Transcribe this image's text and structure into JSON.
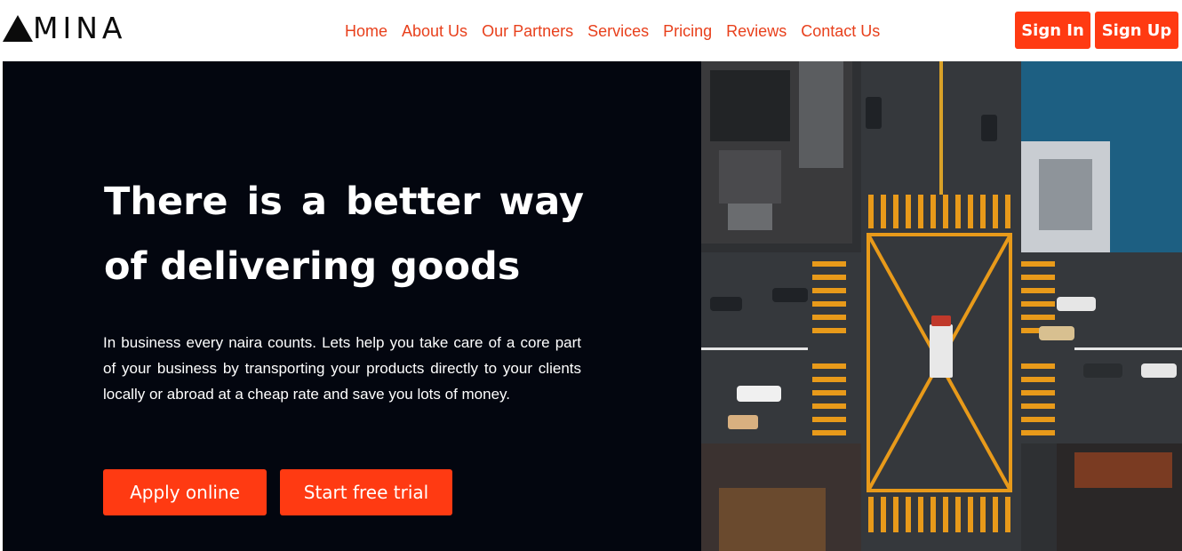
{
  "brand": {
    "logo_text": "MINA",
    "logo_icon": "triangle-a-icon"
  },
  "nav": {
    "items": [
      {
        "label": "Home"
      },
      {
        "label": "About Us"
      },
      {
        "label": "Our Partners"
      },
      {
        "label": "Services"
      },
      {
        "label": "Pricing"
      },
      {
        "label": "Reviews"
      },
      {
        "label": "Contact Us"
      }
    ]
  },
  "auth": {
    "sign_in": "Sign In",
    "sign_up": "Sign Up"
  },
  "hero": {
    "title": "There is a better way of delivering goods",
    "description": "In business every naira counts. Lets help you take care of a core part of your business by transporting your products directly to your clients locally or abroad at a cheap rate and save you lots of money.",
    "apply_label": "Apply online",
    "trial_label": "Start free trial"
  },
  "colors": {
    "accent": "#ff3a12",
    "nav_link": "#e8401c",
    "hero_bg": "#03060f",
    "road_marking": "#e89a1a"
  }
}
